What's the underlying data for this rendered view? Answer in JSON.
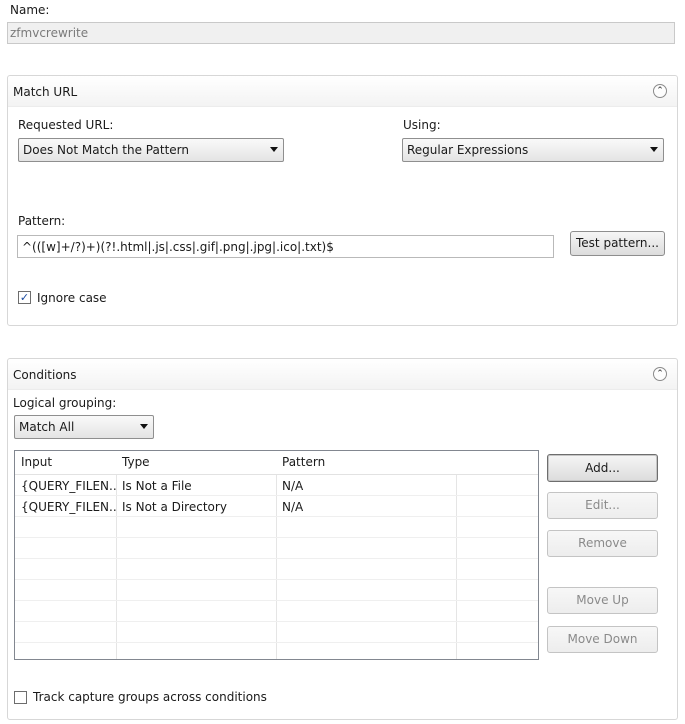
{
  "name": {
    "label": "Name:",
    "value": "zfmvcrewrite"
  },
  "match_url": {
    "title": "Match URL",
    "requested_url_label": "Requested URL:",
    "requested_url_value": "Does Not Match the Pattern",
    "using_label": "Using:",
    "using_value": "Regular Expressions",
    "pattern_label": "Pattern:",
    "pattern_value": "^(([w]+/?)+)(?!.html|.js|.css|.gif|.png|.jpg|.ico|.txt)$",
    "test_pattern_label": "Test pattern...",
    "ignore_case_label": "Ignore case",
    "ignore_case_checked": true
  },
  "conditions": {
    "title": "Conditions",
    "logical_grouping_label": "Logical grouping:",
    "logical_grouping_value": "Match All",
    "columns": [
      "Input",
      "Type",
      "Pattern"
    ],
    "rows": [
      {
        "input": "{QUERY_FILEN...",
        "type": "Is Not a File",
        "pattern": "N/A"
      },
      {
        "input": "{QUERY_FILEN...",
        "type": "Is Not a Directory",
        "pattern": "N/A"
      }
    ],
    "buttons": {
      "add": "Add...",
      "edit": "Edit...",
      "remove": "Remove",
      "move_up": "Move Up",
      "move_down": "Move Down"
    },
    "track_capture_label": "Track capture groups across conditions",
    "track_capture_checked": false
  }
}
